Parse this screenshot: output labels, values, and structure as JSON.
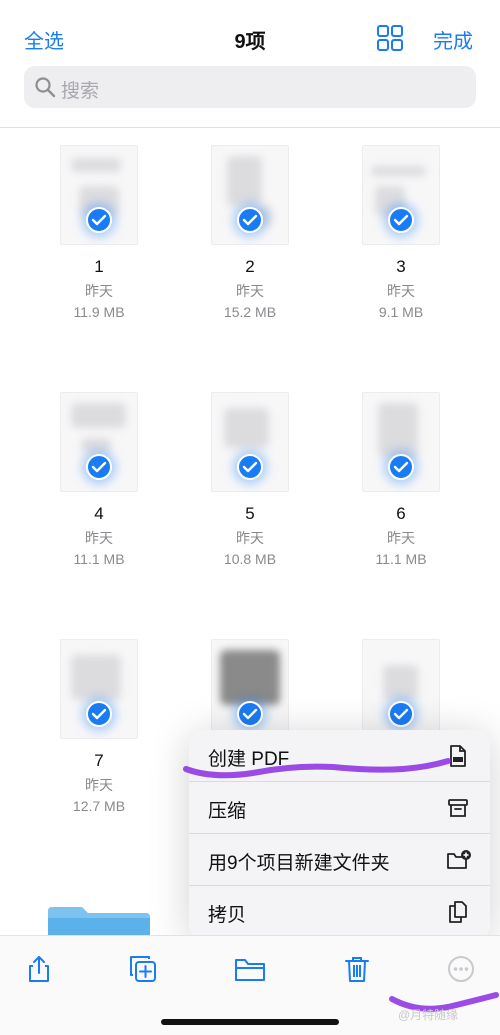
{
  "header": {
    "select_all": "全选",
    "title": "9项",
    "grid_view_icon": "grid-icon",
    "done": "完成"
  },
  "search": {
    "placeholder": "搜索",
    "icon": "search-icon"
  },
  "files": [
    {
      "name": "1",
      "date": "昨天",
      "size": "11.9 MB"
    },
    {
      "name": "2",
      "date": "昨天",
      "size": "15.2 MB"
    },
    {
      "name": "3",
      "date": "昨天",
      "size": "9.1 MB"
    },
    {
      "name": "4",
      "date": "昨天",
      "size": "11.1 MB"
    },
    {
      "name": "5",
      "date": "昨天",
      "size": "10.8 MB"
    },
    {
      "name": "6",
      "date": "昨天",
      "size": "11.1 MB"
    },
    {
      "name": "7",
      "date": "昨天",
      "size": "12.7 MB"
    },
    {
      "name": "",
      "date": "",
      "size": ""
    },
    {
      "name": "",
      "date": "",
      "size": ""
    }
  ],
  "context_menu": {
    "items": [
      {
        "label": "创建 PDF",
        "icon": "pdf-document-icon"
      },
      {
        "label": "压缩",
        "icon": "archive-box-icon"
      },
      {
        "label": "用9个项目新建文件夹",
        "icon": "new-folder-icon"
      },
      {
        "label": "拷贝",
        "icon": "copy-icon"
      }
    ]
  },
  "toolbar": {
    "share_icon": "share-icon",
    "duplicate_icon": "duplicate-icon",
    "move_icon": "folder-icon",
    "delete_icon": "trash-icon",
    "more_icon": "more-icon"
  },
  "colors": {
    "accent": "#1a7cf5",
    "annotation": "#8a2be2"
  },
  "watermark": "@月特随缘"
}
